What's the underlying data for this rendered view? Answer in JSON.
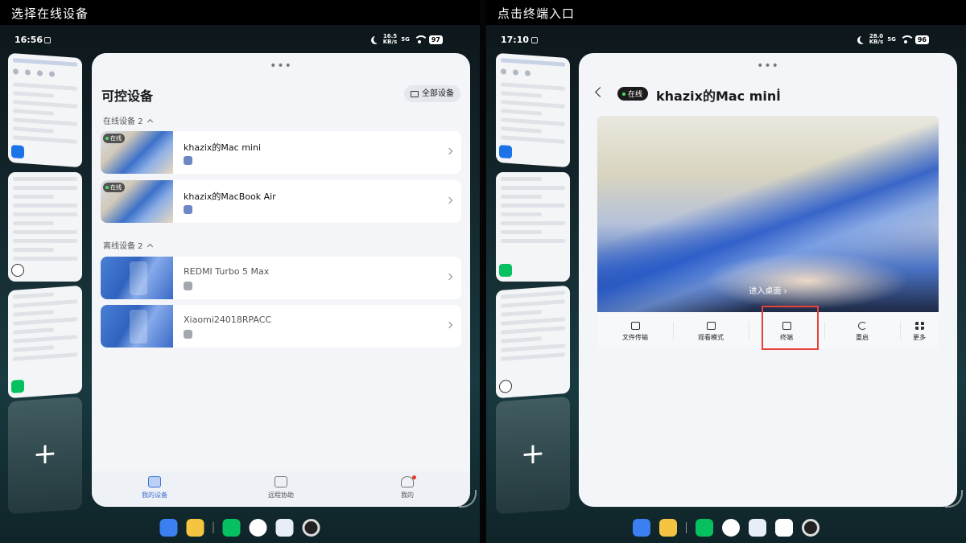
{
  "left": {
    "caption": "选择在线设备",
    "status": {
      "time": "16:56",
      "speed_value": "16.5",
      "speed_unit": "KB/s",
      "signal": "5G",
      "battery": "97"
    },
    "app": {
      "title": "可控设备",
      "all_devices_label": "全部设备",
      "online_section": "在线设备 2",
      "offline_section": "离线设备 2",
      "online_badge": "在线",
      "devices_online": [
        {
          "name": "khazix的Mac mini"
        },
        {
          "name": "khazix的MacBook Air"
        }
      ],
      "devices_offline": [
        {
          "name": "REDMI Turbo 5 Max"
        },
        {
          "name": "Xiaomi24018RPACC"
        }
      ],
      "tabs": [
        {
          "label": "我的设备"
        },
        {
          "label": "远程协助"
        },
        {
          "label": "我的"
        }
      ]
    },
    "add_label": "+"
  },
  "right": {
    "caption": "点击终端入口",
    "status": {
      "time": "17:10",
      "speed_value": "28.0",
      "speed_unit": "KB/s",
      "signal": "5G",
      "battery": "96"
    },
    "detail": {
      "online_label": "在线",
      "title": "khazix的Mac mini",
      "enter_desktop": "进入桌面 ›",
      "actions": [
        {
          "label": "文件传输"
        },
        {
          "label": "观看模式"
        },
        {
          "label": "终端"
        },
        {
          "label": "重启"
        },
        {
          "label": "更多"
        }
      ]
    },
    "add_label": "+"
  },
  "colors": {
    "accent": "#3d6fd6",
    "highlight": "#e8413a",
    "online_dot": "#4ade6f"
  }
}
